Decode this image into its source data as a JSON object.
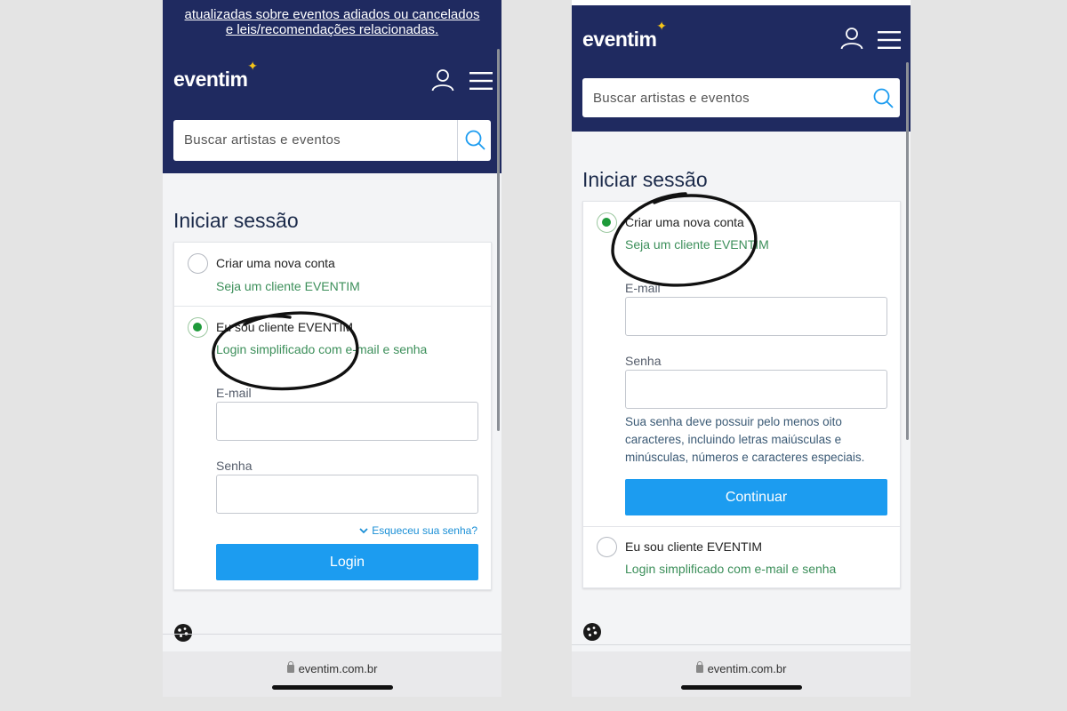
{
  "left": {
    "banner": {
      "line1": "atualizadas sobre eventos adiados ou cancelados",
      "line2": "e leis/recomendações relacionadas."
    },
    "logo": "eventim",
    "search_placeholder": "Buscar artistas e eventos",
    "page_title": "Iniciar sessão",
    "option_new": {
      "title": "Criar uma nova conta",
      "subtitle": "Seja um cliente EVENTIM",
      "selected": false
    },
    "option_existing": {
      "title": "Eu sou cliente EVENTIM",
      "subtitle": "Login simplificado com e-mail e senha",
      "selected": true
    },
    "email_label": "E-mail",
    "password_label": "Senha",
    "forgot_password": "Esqueceu sua senha?",
    "login_button": "Login",
    "url": "eventim.com.br"
  },
  "right": {
    "logo": "eventim",
    "search_placeholder": "Buscar artistas e eventos",
    "page_title": "Iniciar sessão",
    "option_new": {
      "title": "Criar uma nova conta",
      "subtitle": "Seja um cliente EVENTIM",
      "selected": true
    },
    "email_label": "E-mail",
    "password_label": "Senha",
    "password_hint": "Sua senha deve possuir pelo menos oito caracteres, incluindo letras maiúsculas e minúsculas, números e caracteres especiais.",
    "continue_button": "Continuar",
    "option_existing": {
      "title": "Eu sou cliente EVENTIM",
      "subtitle": "Login simplificado com e-mail e senha",
      "selected": false
    },
    "url": "eventim.com.br"
  },
  "icons": [
    "user-icon",
    "menu-icon",
    "search-icon",
    "chevron-down-icon",
    "cookie-icon",
    "lock-icon",
    "star-icon"
  ],
  "colors": {
    "header_bg": "#1f2a60",
    "primary_button": "#1c9cf0",
    "radio_selected": "#1e9a3a",
    "subtitle_green": "#3c8f5a",
    "logo_star": "#f5c518",
    "annotation_ink": "#111111"
  }
}
